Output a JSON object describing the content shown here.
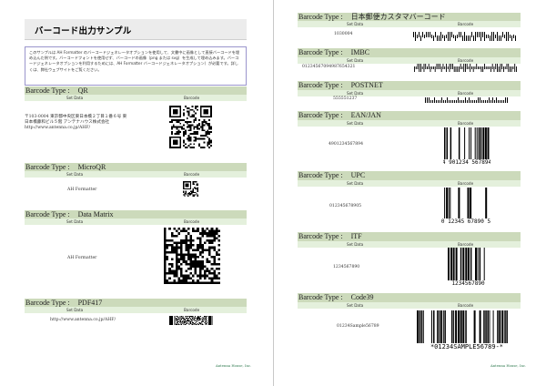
{
  "left": {
    "title": "バーコード出力サンプル",
    "desc": "このサンプルは AH Formatter のバーコードジェネレータオプションを使用して、文書中に画像として直接バーコードを埋め込んだ例です。バーコードフォントを使用せず、バーコードの画像（png または svg）を生成して埋め込みます。バーコードジェネレータオプションを利用するためには、AH Formatter バーコードジェネレータオプション）が必要です。詳しくは、弊社ウェブサイトをご覧ください。",
    "sections": [
      {
        "label": "Barcode Type :",
        "type": "QR",
        "data": [
          "〒103-0004 東京都中央区東日本橋２丁目１番６号 東",
          "日本橋藤和ビル５階 アンテナハウス株式会社",
          "http://www.antenna.co.jp/AHF/"
        ]
      },
      {
        "label": "Barcode Type :",
        "type": "MicroQR",
        "data": [
          "AH Formatter"
        ]
      },
      {
        "label": "Barcode Type :",
        "type": "Data Matrix",
        "data": [
          "AH Formatter"
        ]
      },
      {
        "label": "Barcode Type :",
        "type": "PDF417",
        "data": [
          "http://www.antenna.co.jp/AHF/"
        ]
      }
    ],
    "footer": "Antenna House, Inc."
  },
  "right": {
    "sections": [
      {
        "label": "Barcode Type :",
        "type": "日本郵便カスタマバーコード",
        "data": "1030004"
      },
      {
        "label": "Barcode Type :",
        "type": "IMBC",
        "data": "01234567094987654321"
      },
      {
        "label": "Barcode Type :",
        "type": "POSTNET",
        "data": "555551237"
      },
      {
        "label": "Barcode Type :",
        "type": "EAN/JAN",
        "data": "4901234567894",
        "text": "4 901234 567894"
      },
      {
        "label": "Barcode Type :",
        "type": "UPC",
        "data": "012345678905",
        "text": "0 12345 67890 5"
      },
      {
        "label": "Barcode Type :",
        "type": "ITF",
        "data": "1234567890",
        "text": "1234567890"
      },
      {
        "label": "Barcode Type :",
        "type": "Code39",
        "data": "01234Sample56789",
        "text": "*01234SAMPLE56789-*"
      }
    ],
    "footer": "Antenna House, Inc."
  },
  "col_set_data": "Set Data",
  "col_barcode": "Barcode"
}
